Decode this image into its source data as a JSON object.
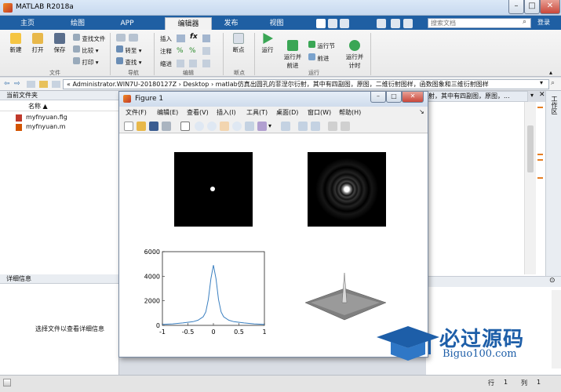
{
  "app": {
    "title": "MATLAB R2018a",
    "search_placeholder": "搜索文档",
    "login": "登录"
  },
  "ribbon_tabs": [
    "主页",
    "绘图",
    "APP",
    "编辑器",
    "发布",
    "视图"
  ],
  "ribbon": {
    "file": {
      "new": "新建",
      "open": "打开",
      "save": "保存",
      "find_file": "查找文件",
      "compare": "比较",
      "print": "打印",
      "group": "文件"
    },
    "nav": {
      "goto": "转至",
      "find": "查找",
      "group": "导航"
    },
    "edit": {
      "insert": "插入",
      "comment": "注释",
      "indent": "缩进",
      "fx": "fx",
      "group": "编辑"
    },
    "breakpoints": {
      "label": "断点",
      "group": "断点"
    },
    "run": {
      "run": "运行",
      "run_advance": "运行并\n前进",
      "run_section": "运行节",
      "advance": "前进",
      "run_time": "运行并\n计时",
      "group": "运行"
    }
  },
  "address": {
    "parts": [
      "«",
      "Administrator.WIN7U-20180127Z",
      "›",
      "Desktop",
      "›",
      "matlab仿真出圆孔的菲涅尔衍射，其中有四副图，原图，二维衍射图样，函数图象和三维衍射图样"
    ]
  },
  "left": {
    "title": "当前文件夹",
    "col_name": "名称 ▲",
    "files": [
      "myfnyuan.fig",
      "myfnyuan.m"
    ]
  },
  "detail": {
    "title": "详细信息",
    "hint": "选择文件以查看详细信息"
  },
  "right_strip": {
    "title": "工作区",
    "editor_tab_text": "射，其中有四副图，原图，..."
  },
  "figure": {
    "title": "Figure 1",
    "menu": [
      "文件(F)",
      "编辑(E)",
      "查看(V)",
      "插入(I)",
      "工具(T)",
      "桌面(D)",
      "窗口(W)",
      "帮助(H)"
    ],
    "plot": {
      "yticks": [
        "6000",
        "4000",
        "2000",
        "0"
      ],
      "xticks": [
        "-1",
        "-0.5",
        "0",
        "0.5",
        "1"
      ]
    }
  },
  "status": {
    "row_label": "行",
    "row": "1",
    "col_label": "列",
    "col": "1"
  },
  "watermark": {
    "name": "必过源码",
    "url": "Biguo100.com"
  },
  "chart_data": {
    "type": "line",
    "x": [
      -1,
      -0.8,
      -0.6,
      -0.4,
      -0.3,
      -0.2,
      -0.15,
      -0.1,
      -0.05,
      0,
      0.05,
      0.1,
      0.15,
      0.2,
      0.3,
      0.4,
      0.6,
      0.8,
      1
    ],
    "values": [
      80,
      120,
      200,
      300,
      420,
      700,
      1100,
      2100,
      3800,
      4900,
      3800,
      2100,
      1100,
      700,
      420,
      300,
      200,
      120,
      80
    ],
    "xlim": [
      -1,
      1
    ],
    "ylim": [
      0,
      6000
    ],
    "color": "#3a7fc0"
  }
}
